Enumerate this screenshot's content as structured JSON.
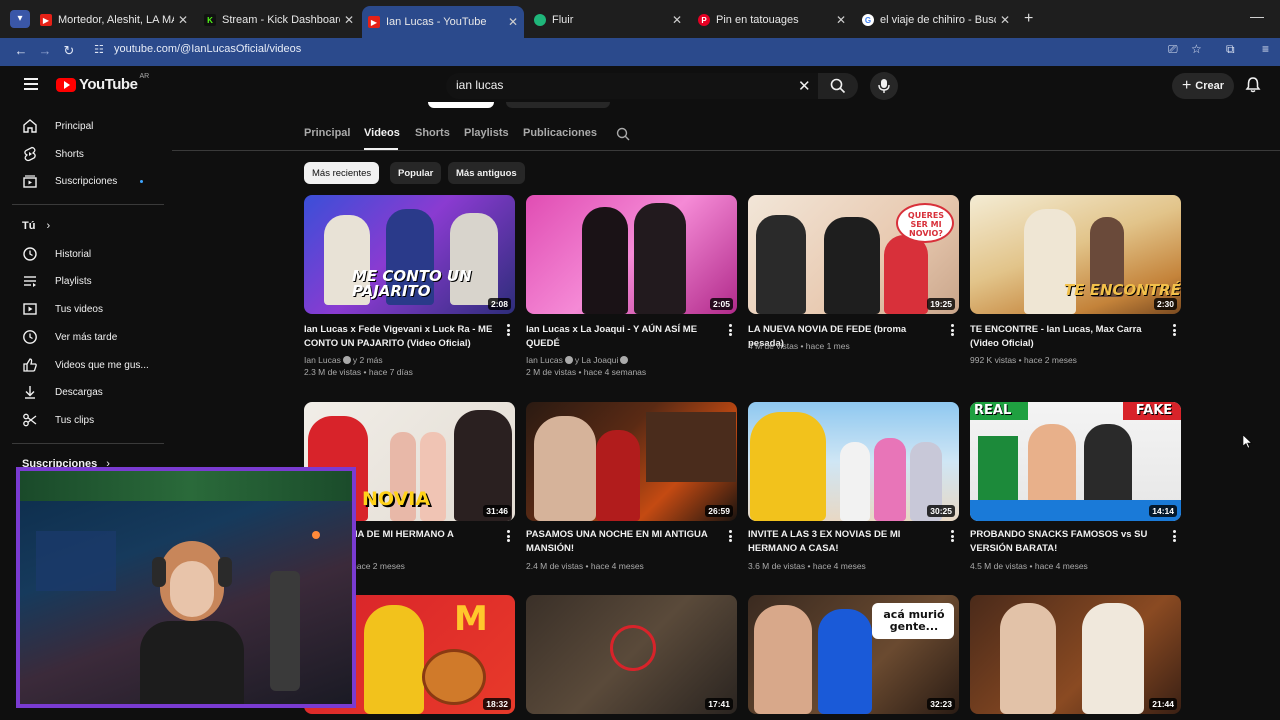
{
  "browser": {
    "tabs": [
      {
        "title": "Mortedor, Aleshit, LA MAFIA C...",
        "favicon_color": "#e62117",
        "icon": "youtube-icon"
      },
      {
        "title": "Stream - Kick Dashboard",
        "favicon_color": "#53fc18",
        "icon": "kick-icon"
      },
      {
        "title": "Ian Lucas - YouTube",
        "favicon_color": "#e62117",
        "icon": "youtube-icon",
        "active": true
      },
      {
        "title": "Fluir",
        "favicon_color": "#1fb67a",
        "icon": "fluir-icon"
      },
      {
        "title": "Pin en tatouages",
        "favicon_color": "#e60023",
        "icon": "pinterest-icon"
      },
      {
        "title": "el viaje de chihiro - Buscar con...",
        "favicon_color": "#4285f4",
        "icon": "google-icon"
      }
    ],
    "url": "youtube.com/@IanLucasOficial/videos"
  },
  "header": {
    "logo_text": "YouTube",
    "logo_region": "AR",
    "search_value": "ian lucas",
    "create_label": "Crear"
  },
  "sidebar": {
    "top_items": [
      {
        "label": "Principal",
        "icon": "home-icon"
      },
      {
        "label": "Shorts",
        "icon": "shorts-icon"
      },
      {
        "label": "Suscripciones",
        "icon": "subscriptions-icon"
      }
    ],
    "you_heading": "Tú",
    "you_items": [
      {
        "label": "Historial",
        "icon": "history-icon"
      },
      {
        "label": "Playlists",
        "icon": "playlists-icon"
      },
      {
        "label": "Tus videos",
        "icon": "your-videos-icon"
      },
      {
        "label": "Ver más tarde",
        "icon": "watch-later-icon"
      },
      {
        "label": "Videos que me gus...",
        "icon": "liked-videos-icon"
      },
      {
        "label": "Descargas",
        "icon": "downloads-icon"
      },
      {
        "label": "Tus clips",
        "icon": "clips-icon"
      }
    ],
    "subs_heading": "Suscripciones"
  },
  "channel_tabs": [
    "Principal",
    "Videos",
    "Shorts",
    "Playlists",
    "Publicaciones"
  ],
  "active_tab": "Videos",
  "chips": [
    "Más recientes",
    "Popular",
    "Más antiguos"
  ],
  "videos": [
    {
      "title": "Ian Lucas x Fede Vigevani x Luck Ra - ME CONTO UN PAJARITO (Video Oficial)",
      "channel": "Ian Lucas",
      "extra": "y 2 más",
      "views": "2.3 M de vistas",
      "age": "hace 7 días",
      "duration": "2:08",
      "thumb_text": "ME CONTO UN PAJARITO"
    },
    {
      "title": "Ian Lucas x La Joaqui - Y AÚN ASÍ ME QUEDÉ",
      "channel": "Ian Lucas",
      "extra": "y La Joaqui",
      "views": "2 M de vistas",
      "age": "hace 4 semanas",
      "duration": "2:05",
      "thumb_text": ""
    },
    {
      "title": "LA NUEVA NOVIA DE FEDE (broma pesada)",
      "channel": "",
      "extra": "",
      "views": "4 M de vistas",
      "age": "hace 1 mes",
      "duration": "19:25",
      "thumb_text": "QUERES SER MI NOVIO?"
    },
    {
      "title": "TE ENCONTRE - Ian Lucas, Max Carra (Video Oficial)",
      "channel": "",
      "extra": "",
      "views": "992 K vistas",
      "age": "hace 2 meses",
      "duration": "2:30",
      "thumb_text": "TE ENCONTRÉ"
    },
    {
      "title": "LA EX NOVIA DE MI HERMANO A",
      "channel": "",
      "extra": "",
      "views": "",
      "age": "hace 2 meses",
      "duration": "31:46",
      "thumb_text": "NOVIA"
    },
    {
      "title": "PASAMOS UNA NOCHE EN MI ANTIGUA MANSIÓN!",
      "channel": "",
      "extra": "",
      "views": "2.4 M de vistas",
      "age": "hace 4 meses",
      "duration": "26:59",
      "thumb_text": ""
    },
    {
      "title": "INVITE A LAS 3 EX NOVIAS DE MI HERMANO A CASA!",
      "channel": "",
      "extra": "",
      "views": "3.6 M de vistas",
      "age": "hace 4 meses",
      "duration": "30:25",
      "thumb_text": ""
    },
    {
      "title": "PROBANDO SNACKS FAMOSOS vs SU VERSIÓN BARATA!",
      "channel": "",
      "extra": "",
      "views": "4.5 M de vistas",
      "age": "hace 4 meses",
      "duration": "14:14",
      "thumb_text": "REAL FAKE"
    },
    {
      "title": "",
      "channel": "",
      "extra": "",
      "views": "",
      "age": "",
      "duration": "18:32",
      "thumb_text": "M"
    },
    {
      "title": "",
      "channel": "",
      "extra": "",
      "views": "",
      "age": "",
      "duration": "17:41",
      "thumb_text": ""
    },
    {
      "title": "",
      "channel": "",
      "extra": "",
      "views": "",
      "age": "",
      "duration": "32:23",
      "thumb_text": "acá murió gente..."
    },
    {
      "title": "",
      "channel": "",
      "extra": "",
      "views": "",
      "age": "",
      "duration": "21:44",
      "thumb_text": ""
    }
  ],
  "colors": {
    "background": "#0f0f0f",
    "browser_accent": "#2b4a8c",
    "youtube_red": "#ff0000",
    "webcam_border": "#7a3bd1"
  }
}
